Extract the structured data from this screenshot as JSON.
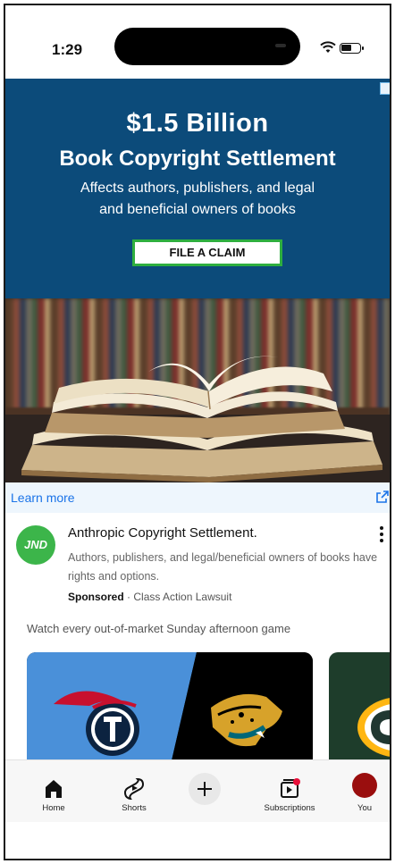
{
  "status_bar": {
    "time": "1:29"
  },
  "ad": {
    "headline": "$1.5 Billion",
    "subheadline": "Book Copyright Settlement",
    "description_line1": "Affects authors, publishers, and legal",
    "description_line2": "and beneficial owners of books",
    "cta_label": "FILE A CLAIM",
    "learn_more_label": "Learn more",
    "colors": {
      "banner": "#0c4b7a",
      "cta_border": "#2eae3f",
      "link": "#1a73e8"
    }
  },
  "sponsored_item": {
    "avatar_text": "JND",
    "title": "Anthropic Copyright Settlement.",
    "description_line1": "Authors, publishers, and legal/beneficial owners of books have",
    "description_line2": "rights and options.",
    "sponsored_label": "Sponsored",
    "separator": "·",
    "advertiser": "Class Action Lawsuit",
    "avatar_color": "#3cb54a"
  },
  "feed": {
    "section_text": "Watch every out-of-market Sunday afternoon game",
    "cards": [
      {
        "name": "titans-vs-jaguars",
        "icons": [
          "titans-logo-icon",
          "jaguars-logo-icon"
        ]
      },
      {
        "name": "packers",
        "icons": [
          "packers-logo-icon"
        ]
      }
    ]
  },
  "bottom_nav": {
    "items": [
      {
        "label": "Home",
        "icon": "home-icon"
      },
      {
        "label": "Shorts",
        "icon": "shorts-icon"
      },
      {
        "label": "",
        "icon": "plus-icon"
      },
      {
        "label": "Subscriptions",
        "icon": "subscriptions-icon"
      },
      {
        "label": "You",
        "icon": "avatar"
      }
    ],
    "you_avatar_color": "#9a0e0e"
  }
}
